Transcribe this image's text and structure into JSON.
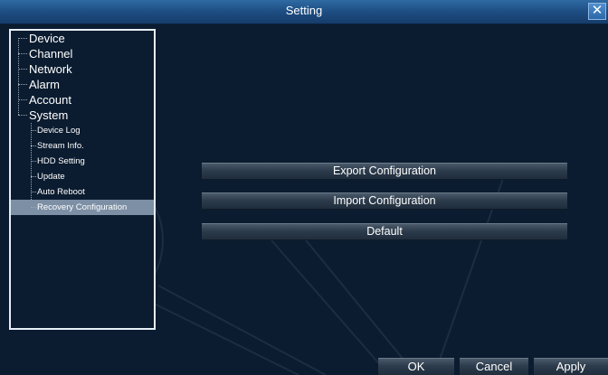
{
  "window": {
    "title": "Setting",
    "close_symbol": "✕"
  },
  "tree": {
    "top_items": [
      {
        "label": "Device"
      },
      {
        "label": "Channel"
      },
      {
        "label": "Network"
      },
      {
        "label": "Alarm"
      },
      {
        "label": "Account"
      },
      {
        "label": "System"
      }
    ],
    "system_children": [
      {
        "label": "Device Log"
      },
      {
        "label": "Stream Info."
      },
      {
        "label": "HDD Setting"
      },
      {
        "label": "Update"
      },
      {
        "label": "Auto Reboot"
      },
      {
        "label": "Recovery Configuration",
        "selected": true
      }
    ]
  },
  "main": {
    "export_label": "Export Configuration",
    "import_label": "Import Configuration",
    "default_label": "Default"
  },
  "footer": {
    "ok_label": "OK",
    "cancel_label": "Cancel",
    "apply_label": "Apply"
  },
  "colors": {
    "background": "#0b1c30",
    "titlebar": "#1d4d82",
    "selection": "#7c8fa5",
    "button": "#2d3c4c"
  }
}
